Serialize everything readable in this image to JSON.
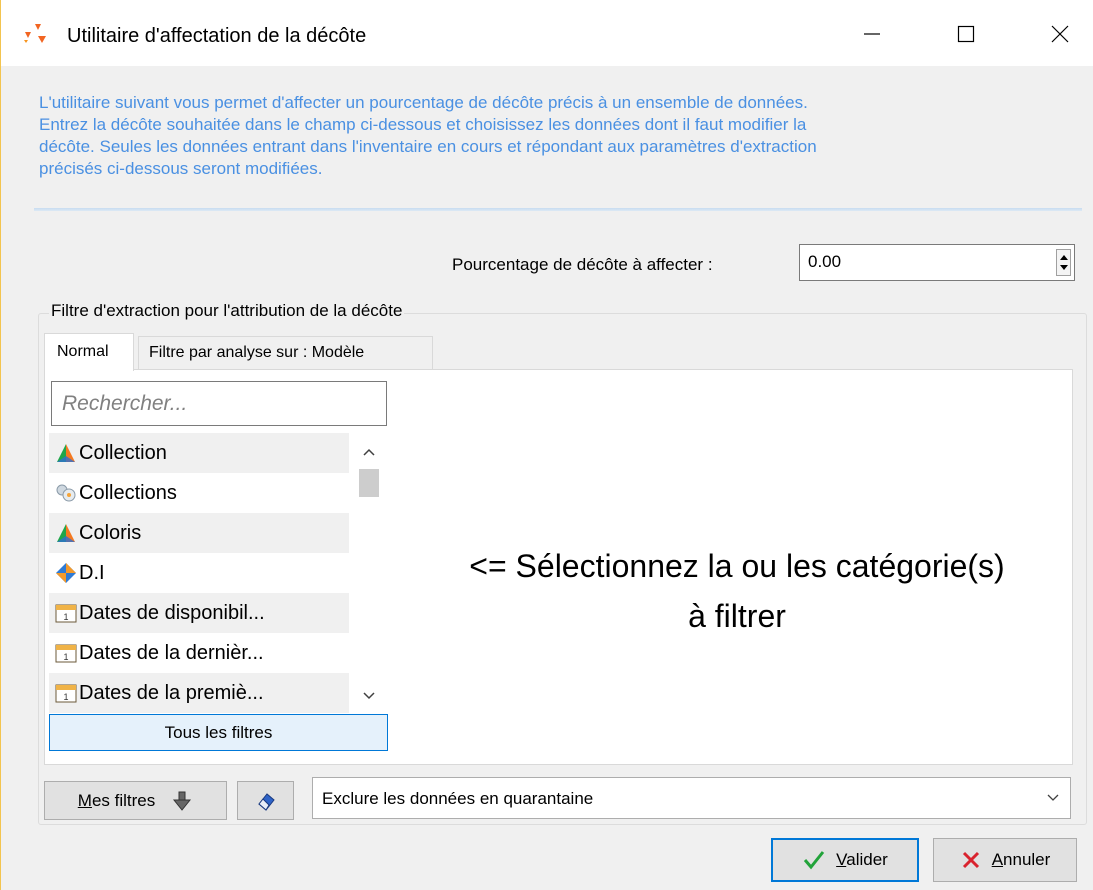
{
  "window": {
    "title": "Utilitaire d'affectation de la décôte",
    "controls": {
      "minimize": "minimize-icon",
      "maximize": "maximize-icon",
      "close": "close-icon"
    }
  },
  "info": {
    "line1": "L'utilitaire suivant vous permet d'affecter un pourcentage de décôte précis à un ensemble de données.",
    "line2": "Entrez la décôte souhaitée dans le champ ci-dessous et choisissez les données dont il faut modifier la",
    "line3": "décôte. Seules les données entrant dans l'inventaire en cours et répondant aux paramètres d'extraction",
    "line4": "précisés ci-dessous seront modifiées.",
    "color": "#4a90e2"
  },
  "percentage": {
    "label": "Pourcentage de décôte à affecter :",
    "value": "0.00"
  },
  "filter_group": {
    "label": "Filtre d'extraction pour l'attribution de la décôte",
    "tabs": [
      {
        "label": "Normal",
        "active": true
      },
      {
        "label": "Filtre par analyse sur : Modèle",
        "active": false
      }
    ],
    "search_placeholder": "Rechercher...",
    "categories": [
      {
        "label": "Collection",
        "icon": "pyramid-icon"
      },
      {
        "label": "Collections",
        "icon": "group-icon"
      },
      {
        "label": "Coloris",
        "icon": "pyramid-icon"
      },
      {
        "label": "D.I",
        "icon": "diamond-icon"
      },
      {
        "label": "Dates de disponibil...",
        "icon": "calendar-icon"
      },
      {
        "label": "Dates de la dernièr...",
        "icon": "calendar-icon"
      },
      {
        "label": "Dates de la premiè...",
        "icon": "calendar-icon"
      }
    ],
    "all_filters_button": "Tous les filtres",
    "placeholder_line1": "<= Sélectionnez la ou les catégorie(s)",
    "placeholder_line2": "à filtrer"
  },
  "footer": {
    "mes_filtres_accel": "M",
    "mes_filtres_rest": "es filtres",
    "quarantine_select": "Exclure les données en quarantaine",
    "valider_accel": "V",
    "valider_rest": "alider",
    "annuler_accel": "A",
    "annuler_rest": "nnuler",
    "accent_color": "#0078d7"
  }
}
